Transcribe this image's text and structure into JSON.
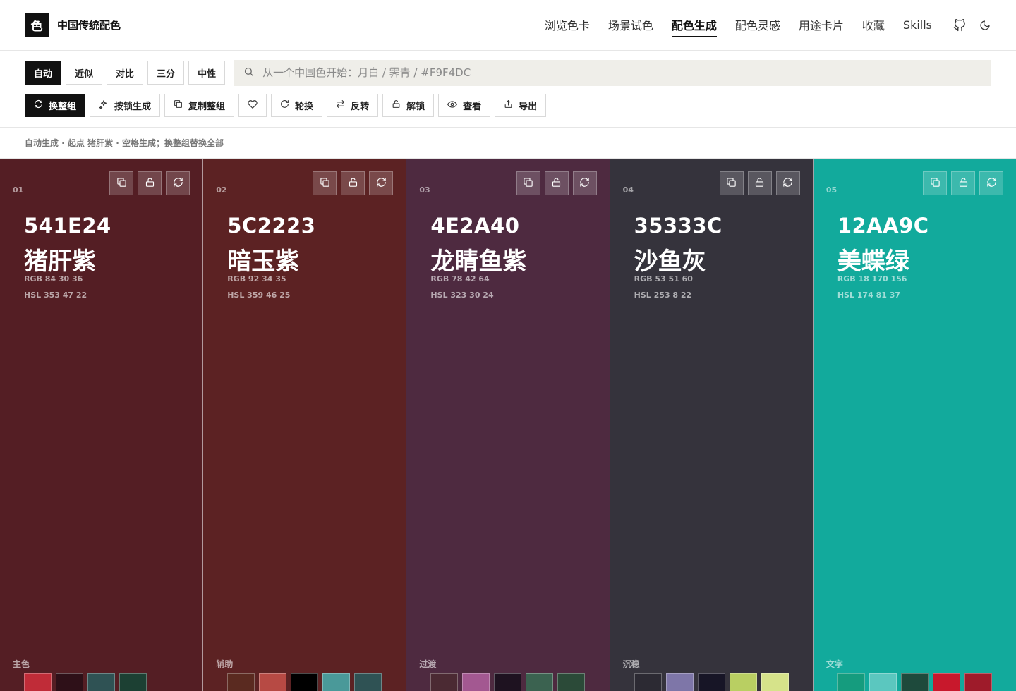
{
  "brand": {
    "logo": "色",
    "name": "中国传统配色"
  },
  "nav": {
    "items": [
      {
        "label": "浏览色卡",
        "active": false
      },
      {
        "label": "场景试色",
        "active": false
      },
      {
        "label": "配色生成",
        "active": true
      },
      {
        "label": "配色灵感",
        "active": false
      },
      {
        "label": "用途卡片",
        "active": false
      },
      {
        "label": "收藏",
        "active": false
      },
      {
        "label": "Skills",
        "active": false
      }
    ],
    "icons": [
      "github-icon",
      "moon-icon"
    ]
  },
  "modes": [
    {
      "label": "自动",
      "active": true
    },
    {
      "label": "近似",
      "active": false
    },
    {
      "label": "对比",
      "active": false
    },
    {
      "label": "三分",
      "active": false
    },
    {
      "label": "中性",
      "active": false
    }
  ],
  "search": {
    "placeholder": "从一个中国色开始：月白 / 霁青 / #F9F4DC",
    "value": ""
  },
  "actions": [
    {
      "label": "换整组",
      "icon": "refresh-icon",
      "primary": true
    },
    {
      "label": "按锁生成",
      "icon": "sparkle-icon",
      "primary": false
    },
    {
      "label": "复制整组",
      "icon": "copy-icon",
      "primary": false
    },
    {
      "label": "",
      "icon": "heart-icon",
      "primary": false
    },
    {
      "label": "轮换",
      "icon": "rotate-icon",
      "primary": false
    },
    {
      "label": "反转",
      "icon": "swap-icon",
      "primary": false
    },
    {
      "label": "解锁",
      "icon": "unlock-icon",
      "primary": false
    },
    {
      "label": "查看",
      "icon": "eye-icon",
      "primary": false
    },
    {
      "label": "导出",
      "icon": "export-icon",
      "primary": false
    }
  ],
  "status": "自动生成 · 起点 猪肝紫 · 空格生成；换整组替换全部",
  "palette": [
    {
      "index": "01",
      "hex": "541E24",
      "name": "猪肝紫",
      "color": "#541E24",
      "rgb": "RGB 84 30 36",
      "hsl": "HSL 353 47 22",
      "role": "主色",
      "swatches": [
        "#C02C38",
        "#2E1018",
        "#2F5254",
        "#1C4033"
      ]
    },
    {
      "index": "02",
      "hex": "5C2223",
      "name": "暗玉紫",
      "color": "#5C2223",
      "rgb": "RGB 92 34 35",
      "hsl": "HSL 359 46 25",
      "role": "辅助",
      "swatches": [
        "#5A2A20",
        "#B74A44",
        "#000000",
        "#4A9999",
        "#2F5254"
      ]
    },
    {
      "index": "03",
      "hex": "4E2A40",
      "name": "龙睛鱼紫",
      "color": "#4E2A40",
      "rgb": "RGB 78 42 64",
      "hsl": "HSL 323 30 24",
      "role": "过渡",
      "swatches": [
        "#4B2A33",
        "#A35891",
        "#1E1220",
        "#3B6250",
        "#2B4A38"
      ]
    },
    {
      "index": "04",
      "hex": "35333C",
      "name": "沙鱼灰",
      "color": "#35333C",
      "rgb": "RGB 53 51 60",
      "hsl": "HSL 253 8 22",
      "role": "沉稳",
      "swatches": [
        "#2C2A33",
        "#7E76A8",
        "#171526",
        "#B9CF62",
        "#D6E38A"
      ]
    },
    {
      "index": "05",
      "hex": "12AA9C",
      "name": "美蝶绿",
      "color": "#12AA9C",
      "rgb": "RGB 18 170 156",
      "hsl": "HSL 174 81 37",
      "role": "文字",
      "swatches": [
        "#159C7E",
        "#5BC7BF",
        "#1E4A3C",
        "#C8182C",
        "#9E1B2A"
      ]
    }
  ]
}
